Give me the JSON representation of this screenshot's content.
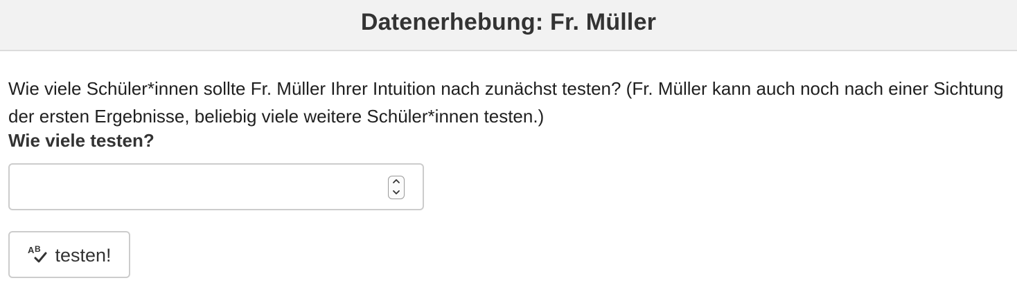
{
  "header": {
    "title": "Datenerhebung: Fr. Müller",
    "background": "#f2f2f2"
  },
  "main": {
    "question": "Wie viele Schüler*innen sollte Fr. Müller Ihrer Intuition nach zunächst testen? (Fr. Müller kann auch noch nach einer Sichtung der ersten Ergebnisse, beliebig viele weitere Schüler*innen testen.)",
    "field_label": "Wie viele testen?",
    "number_input": {
      "value": "",
      "placeholder": ""
    },
    "submit_button": {
      "label": "testen!",
      "icon": "spellcheck-icon"
    }
  }
}
